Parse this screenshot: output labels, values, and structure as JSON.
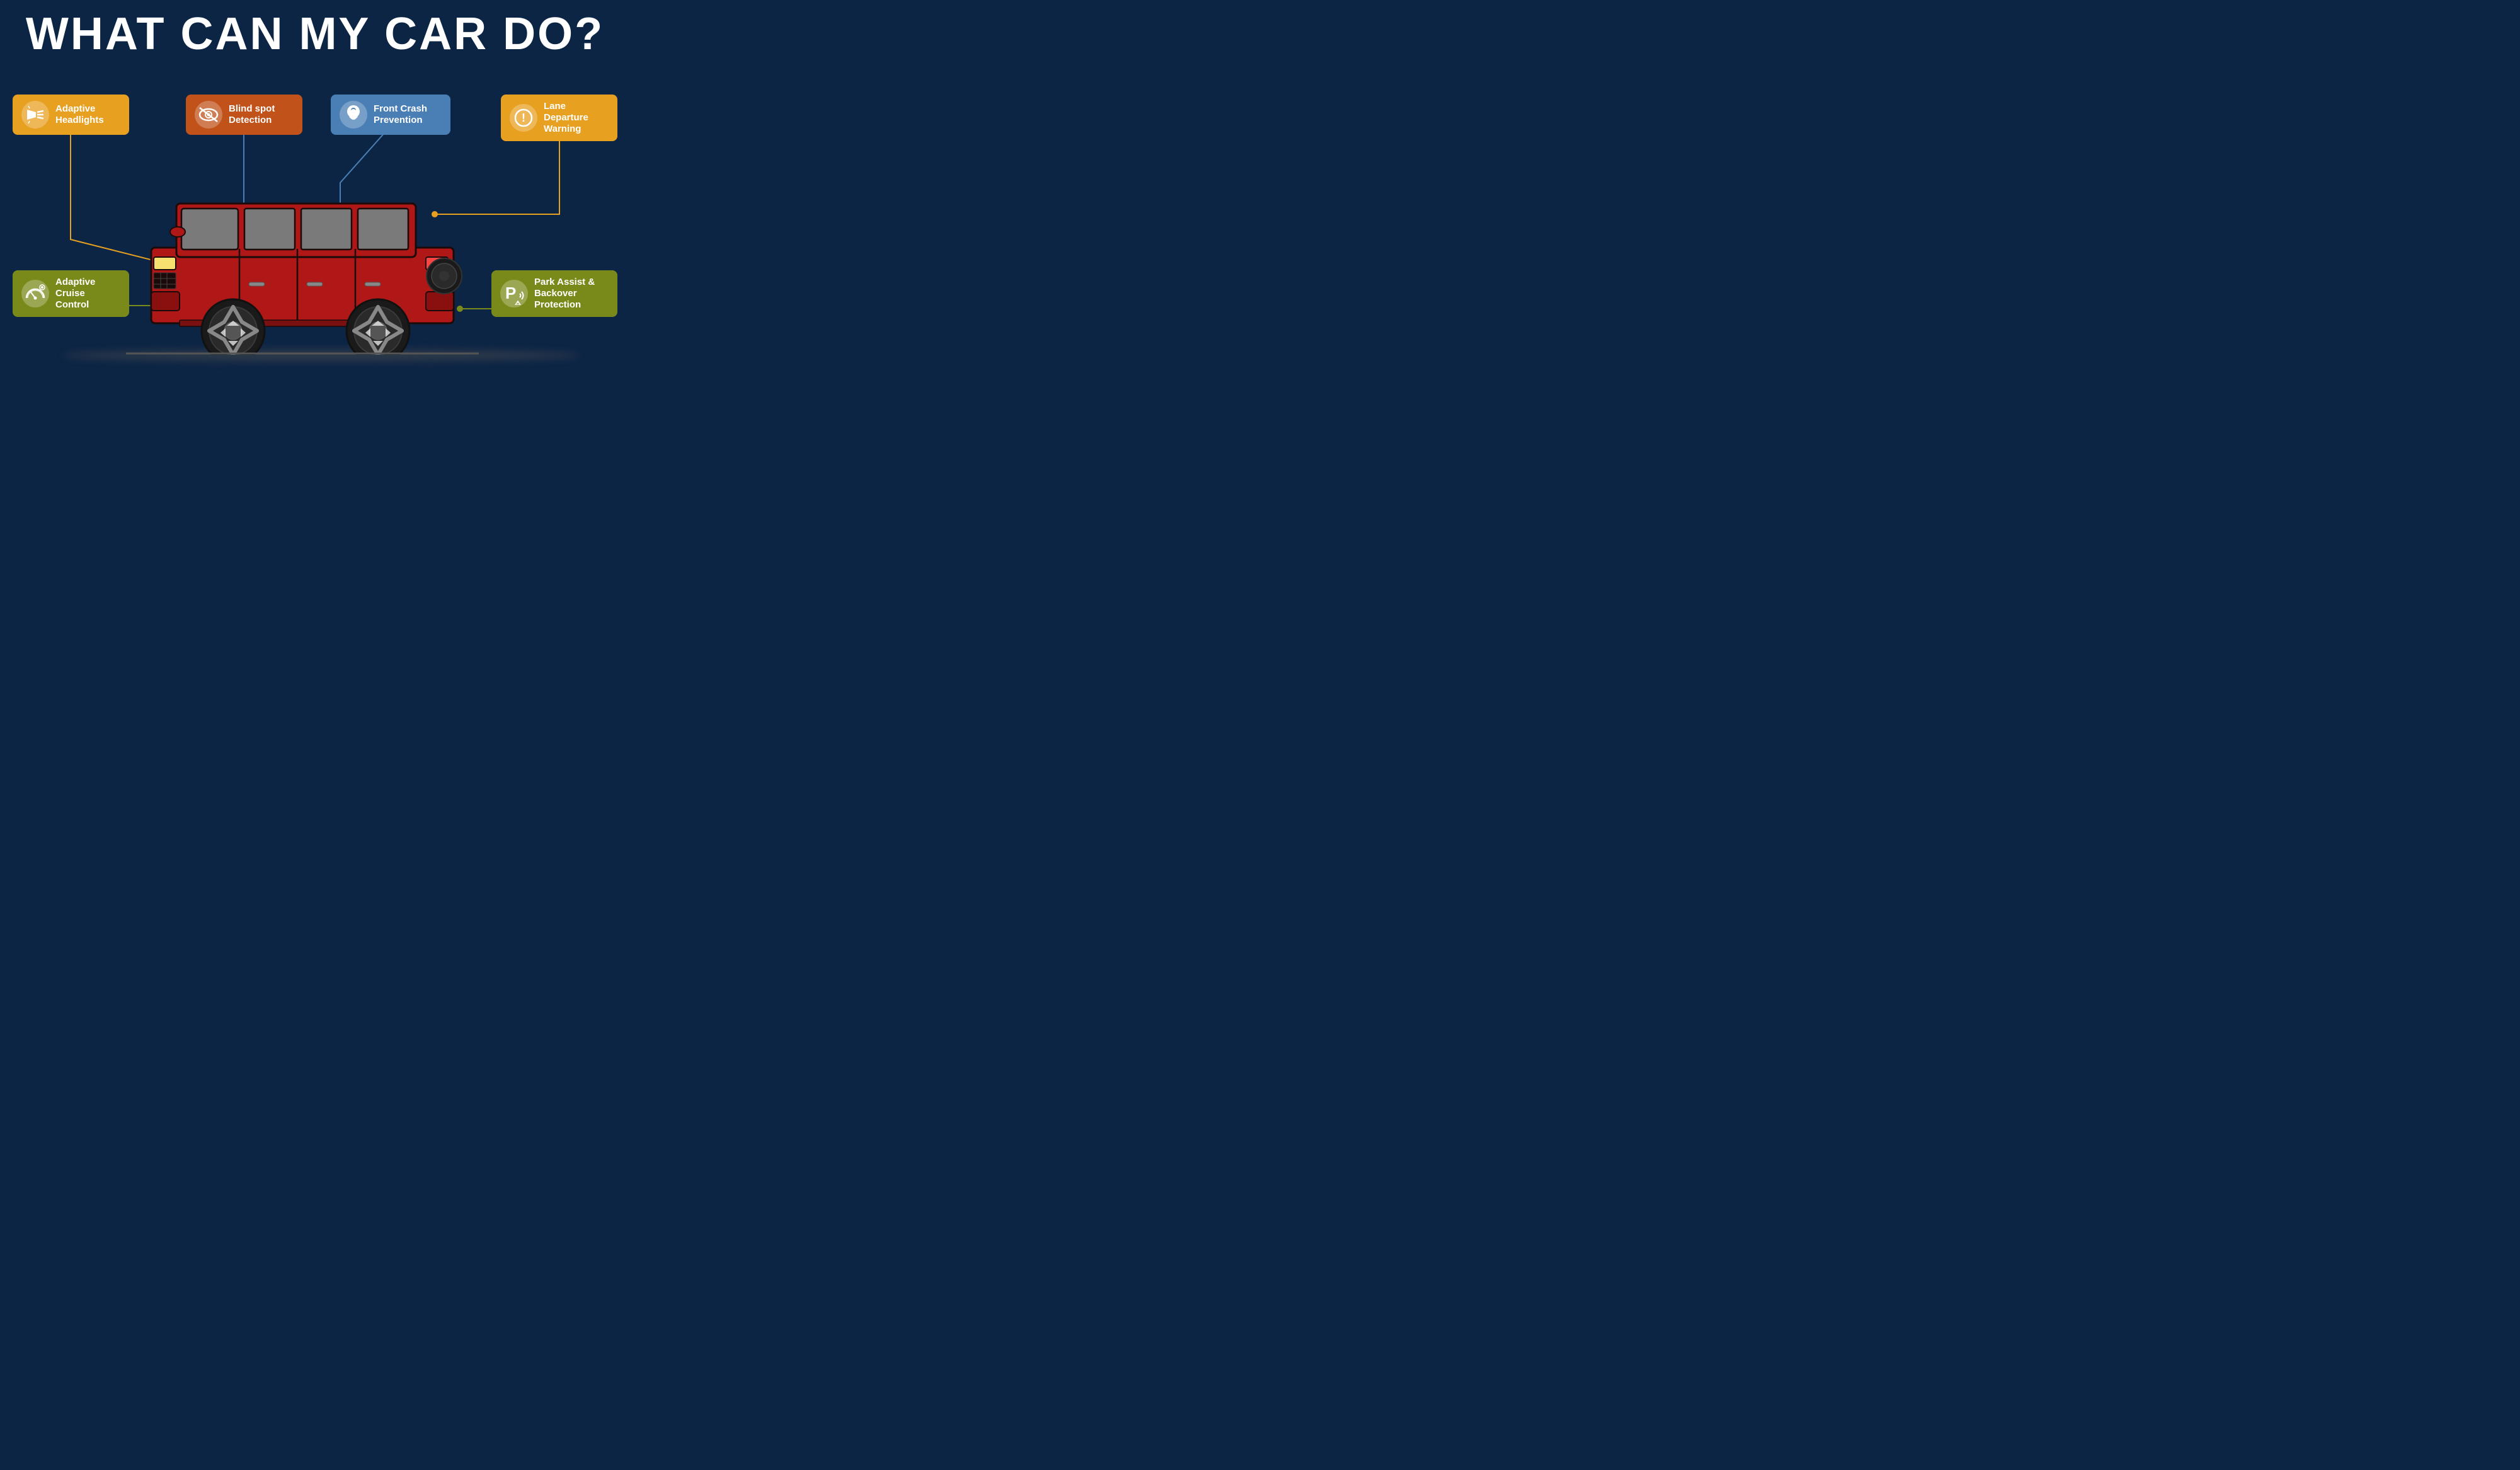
{
  "page": {
    "title": "WHAT CAN MY CAR DO?",
    "background_color": "#0d2545"
  },
  "features": {
    "adaptive_headlights": {
      "label": "Adaptive\nHeadlights",
      "color": "#e8a020",
      "icon": "headlight-icon"
    },
    "blind_spot": {
      "label": "Blind spot\nDetection",
      "color": "#c0521a",
      "icon": "eye-icon"
    },
    "front_crash": {
      "label": "Front Crash\nPrevention",
      "color": "#4a7fb5",
      "icon": "crash-icon"
    },
    "lane_departure": {
      "label": "Lane\nDeparture\nWarning",
      "color": "#e8a020",
      "icon": "warning-icon"
    },
    "cruise_control": {
      "label": "Adaptive\nCruise\nControl",
      "color": "#7a8a1a",
      "icon": "gauge-icon"
    },
    "park_assist": {
      "label": "Park Assist\n& Backover\nProtection",
      "color": "#7a8a1a",
      "icon": "park-icon"
    }
  }
}
